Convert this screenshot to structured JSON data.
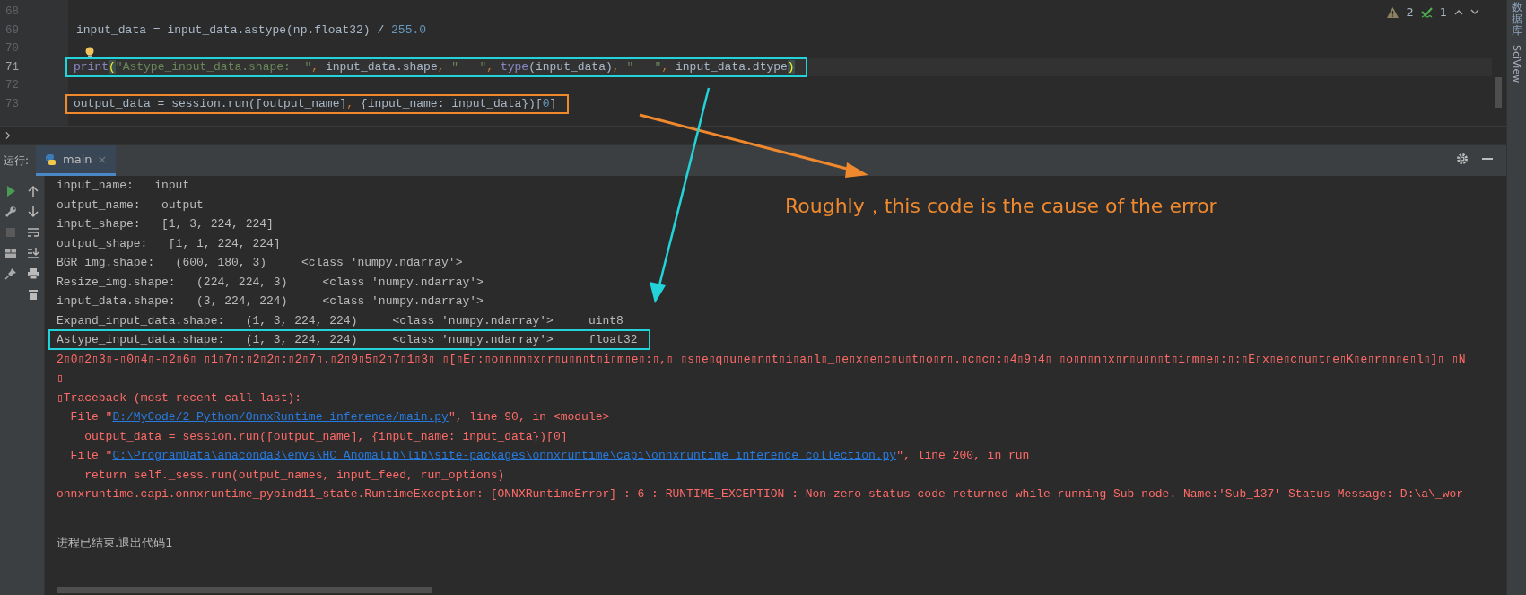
{
  "editor": {
    "lines": [
      {
        "number": "68",
        "current": false
      },
      {
        "number": "69",
        "current": false,
        "tokens": [
          {
            "kind": "plain",
            "text": "input_data = input_data.astype(np.float32) / "
          },
          {
            "kind": "number",
            "text": "255.0"
          }
        ]
      },
      {
        "number": "70",
        "current": false,
        "bulb": true
      },
      {
        "number": "71",
        "current": true,
        "color": "#22d3d9",
        "tokens": [
          {
            "kind": "builtin",
            "text": "print"
          },
          {
            "kind": "brace",
            "text": "("
          },
          {
            "kind": "string",
            "text": "\"Astype_input_data.shape:  \""
          },
          {
            "kind": "comma",
            "text": ", "
          },
          {
            "kind": "plain",
            "text": "input_data.shape"
          },
          {
            "kind": "comma",
            "text": ", "
          },
          {
            "kind": "string",
            "text": "\"   \""
          },
          {
            "kind": "comma",
            "text": ", "
          },
          {
            "kind": "builtin",
            "text": "type"
          },
          {
            "kind": "plain",
            "text": "(input_data)"
          },
          {
            "kind": "comma",
            "text": ", "
          },
          {
            "kind": "string",
            "text": "\"   \""
          },
          {
            "kind": "comma",
            "text": ", "
          },
          {
            "kind": "plain",
            "text": "input_data.dtype"
          },
          {
            "kind": "brace",
            "text": ")"
          }
        ]
      },
      {
        "number": "72",
        "current": false
      },
      {
        "number": "73",
        "current": false,
        "color": "#f0892e",
        "tokens": [
          {
            "kind": "plain",
            "text": "output_data = session.run([output_name]"
          },
          {
            "kind": "comma",
            "text": ", "
          },
          {
            "kind": "plain",
            "text": "{input_name: input_data})["
          },
          {
            "kind": "number",
            "text": "0"
          },
          {
            "kind": "plain",
            "text": "]"
          }
        ]
      }
    ],
    "inspections": {
      "warnings": "2",
      "weak_warnings": "1"
    }
  },
  "run_panel": {
    "label": "运行:",
    "tabs": [
      {
        "label": "main",
        "selected": true,
        "close": "×"
      }
    ]
  },
  "console": {
    "lines": [
      {
        "kind": "out",
        "segments": [
          {
            "text": "input_name:   input"
          }
        ]
      },
      {
        "kind": "out",
        "segments": [
          {
            "text": "output_name:   output"
          }
        ]
      },
      {
        "kind": "out",
        "segments": [
          {
            "text": "input_shape:   [1, 3, 224, 224]"
          }
        ]
      },
      {
        "kind": "out",
        "segments": [
          {
            "text": "output_shape:   [1, 1, 224, 224]"
          }
        ]
      },
      {
        "kind": "out",
        "segments": [
          {
            "text": "BGR_img.shape:   (600, 180, 3)     <class 'numpy.ndarray'>"
          }
        ]
      },
      {
        "kind": "out",
        "segments": [
          {
            "text": "Resize_img.shape:   (224, 224, 3)     <class 'numpy.ndarray'>"
          }
        ]
      },
      {
        "kind": "out",
        "segments": [
          {
            "text": "input_data.shape:   (3, 224, 224)     <class 'numpy.ndarray'>"
          }
        ]
      },
      {
        "kind": "out",
        "segments": [
          {
            "text": "Expand_input_data.shape:   (1, 3, 224, 224)     <class 'numpy.ndarray'>     uint8"
          }
        ]
      },
      {
        "kind": "out",
        "color": "#22d3d9",
        "segments": [
          {
            "text": "Astype_input_data.shape:   (1, 3, 224, 224)     <class 'numpy.ndarray'>     float32"
          }
        ]
      },
      {
        "kind": "error",
        "segments": [
          {
            "text": "2▯0▯2▯3▯-▯0▯4▯-▯2▯6▯ ▯1▯7▯:▯2▯2▯:▯2▯7▯.▯2▯9▯5▯2▯7▯1▯3▯ ▯[▯E▯:▯o▯n▯n▯x▯r▯u▯n▯t▯i▯m▯e▯:▯,▯ ▯s▯e▯q▯u▯e▯n▯t▯i▯a▯l▯_▯e▯x▯e▯c▯u▯t▯o▯r▯.▯c▯c▯:▯4▯9▯4▯ ▯o▯n▯n▯x▯r▯u▯n▯t▯i▯m▯e▯:▯:▯E▯x▯e▯c▯u▯t▯e▯K▯e▯r▯n▯e▯l▯]▯ ▯N"
          }
        ]
      },
      {
        "kind": "error",
        "segments": [
          {
            "text": "▯"
          }
        ]
      },
      {
        "kind": "error",
        "segments": [
          {
            "text": "▯Traceback (most recent call last):"
          }
        ]
      },
      {
        "kind": "error",
        "segments": [
          {
            "text": "  File \""
          },
          {
            "text": "D:/MyCode/2_Python/OnnxRuntime_inference/main.py",
            "link": true
          },
          {
            "text": "\", line 90, in <module>"
          }
        ]
      },
      {
        "kind": "error",
        "segments": [
          {
            "text": "    output_data = session.run([output_name], {input_name: input_data})[0]"
          }
        ]
      },
      {
        "kind": "error",
        "segments": [
          {
            "text": "  File \""
          },
          {
            "text": "C:\\ProgramData\\anaconda3\\envs\\HC_Anomalib\\lib\\site-packages\\onnxruntime\\capi\\onnxruntime_inference_collection.py",
            "link": true
          },
          {
            "text": "\", line 200, in run"
          }
        ]
      },
      {
        "kind": "error",
        "segments": [
          {
            "text": "    return self._sess.run(output_names, input_feed, run_options)"
          }
        ]
      },
      {
        "kind": "error",
        "segments": [
          {
            "text": "onnxruntime.capi.onnxruntime_pybind11_state.RuntimeException: [ONNXRuntimeError] : 6 : RUNTIME_EXCEPTION : Non-zero status code returned while running Sub node. Name:'Sub_137' Status Message: D:\\a\\_wor"
          }
        ]
      }
    ],
    "exit_message": "进程已结束,退出代码1"
  },
  "right_sidebar": {
    "tools": [
      {
        "label": "数据库",
        "kind": "cjk"
      },
      {
        "label": "SciView",
        "kind": "latin"
      }
    ]
  },
  "annotation": {
    "text": "Roughly，this code is the cause of the error",
    "color": "#f0892e"
  }
}
